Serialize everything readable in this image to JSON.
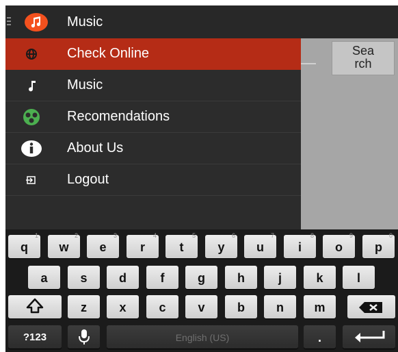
{
  "app": {
    "title": "Music",
    "icon": "music-note-icon",
    "accent_color": "#f4511e"
  },
  "search": {
    "button_label_line1": "Sea",
    "button_label_line2": "rch"
  },
  "drawer": {
    "active_color": "#b52c16",
    "items": [
      {
        "label": "Check Online",
        "icon": "globe-icon",
        "active": true
      },
      {
        "label": "Music",
        "icon": "music-note-icon",
        "active": false
      },
      {
        "label": "Recomendations",
        "icon": "recommendation-icon",
        "active": false
      },
      {
        "label": "About Us",
        "icon": "info-icon",
        "active": false
      },
      {
        "label": "Logout",
        "icon": "logout-icon",
        "active": false
      }
    ]
  },
  "keyboard": {
    "row1": [
      {
        "key": "q",
        "hint": "1"
      },
      {
        "key": "w",
        "hint": "2"
      },
      {
        "key": "e",
        "hint": "3"
      },
      {
        "key": "r",
        "hint": "4"
      },
      {
        "key": "t",
        "hint": "5"
      },
      {
        "key": "y",
        "hint": "6"
      },
      {
        "key": "u",
        "hint": "7"
      },
      {
        "key": "i",
        "hint": "8"
      },
      {
        "key": "o",
        "hint": "9"
      },
      {
        "key": "p",
        "hint": "0"
      }
    ],
    "row2": [
      "a",
      "s",
      "d",
      "f",
      "g",
      "h",
      "j",
      "k",
      "l"
    ],
    "row3": [
      "z",
      "x",
      "c",
      "v",
      "b",
      "n",
      "m"
    ],
    "symbols_label": "?123",
    "space_label": "English (US)",
    "period_label": "."
  }
}
